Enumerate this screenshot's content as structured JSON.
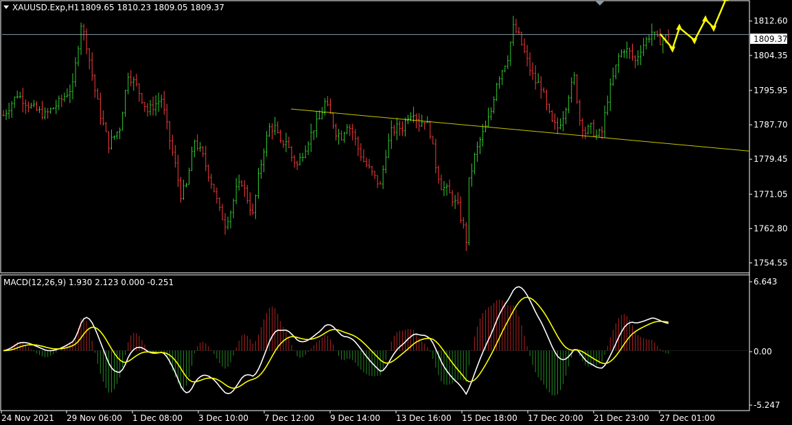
{
  "price_panel": {
    "symbol_label": "XAUUSD.Exp,H1",
    "ohlc_label": "1809.65 1810.23 1809.05 1809.37",
    "current_price": "1809.37",
    "price_ticks": [
      "1812.60",
      "1804.35",
      "1795.95",
      "1787.70",
      "1779.45",
      "1771.05",
      "1762.80",
      "1754.55"
    ]
  },
  "macd_panel": {
    "label": "MACD(12,26,9) 1.930 2.123 0.000 -0.251",
    "ticks": [
      "6.643",
      "0.00",
      "-5.247"
    ]
  },
  "time_ticks": [
    "24 Nov 2021",
    "29 Nov 06:00",
    "1 Dec 08:00",
    "3 Dec 10:00",
    "7 Dec 12:00",
    "9 Dec 14:00",
    "13 Dec 16:00",
    "15 Dec 18:00",
    "17 Dec 20:00",
    "21 Dec 23:00",
    "27 Dec 01:00"
  ],
  "chart_data": {
    "type": "candlestick",
    "symbol": "XAUUSD.Exp",
    "timeframe": "H1",
    "ohlc_last": {
      "open": 1809.65,
      "high": 1810.23,
      "low": 1809.05,
      "close": 1809.37
    },
    "ylim": [
      1752.5,
      1817.0
    ],
    "approx_price_path": [
      [
        0,
        1790
      ],
      [
        5,
        1795
      ],
      [
        10,
        1792
      ],
      [
        15,
        1790
      ],
      [
        20,
        1793
      ],
      [
        25,
        1797
      ],
      [
        28,
        1812
      ],
      [
        30,
        1807
      ],
      [
        33,
        1796
      ],
      [
        35,
        1790
      ],
      [
        38,
        1783
      ],
      [
        42,
        1787
      ],
      [
        45,
        1800
      ],
      [
        48,
        1797
      ],
      [
        52,
        1791
      ],
      [
        57,
        1794
      ],
      [
        60,
        1784
      ],
      [
        62,
        1778
      ],
      [
        64,
        1771
      ],
      [
        66,
        1773
      ],
      [
        69,
        1784
      ],
      [
        72,
        1780
      ],
      [
        74,
        1776
      ],
      [
        76,
        1772
      ],
      [
        78,
        1767
      ],
      [
        80,
        1764
      ],
      [
        82,
        1767
      ],
      [
        84,
        1772
      ],
      [
        86,
        1774
      ],
      [
        88,
        1770
      ],
      [
        90,
        1766
      ],
      [
        92,
        1775
      ],
      [
        94,
        1782
      ],
      [
        96,
        1787
      ],
      [
        98,
        1787
      ],
      [
        100,
        1783
      ],
      [
        102,
        1784
      ],
      [
        104,
        1780
      ],
      [
        106,
        1778
      ],
      [
        108,
        1781
      ],
      [
        110,
        1784
      ],
      [
        112,
        1787
      ],
      [
        114,
        1789
      ],
      [
        116,
        1793
      ],
      [
        118,
        1790
      ],
      [
        120,
        1786
      ],
      [
        122,
        1785
      ],
      [
        124,
        1788
      ],
      [
        126,
        1786
      ],
      [
        128,
        1782
      ],
      [
        130,
        1779
      ],
      [
        132,
        1777
      ],
      [
        134,
        1775
      ],
      [
        136,
        1773
      ],
      [
        138,
        1781
      ],
      [
        140,
        1786
      ],
      [
        142,
        1787
      ],
      [
        144,
        1787
      ],
      [
        146,
        1790
      ],
      [
        148,
        1791
      ],
      [
        150,
        1788
      ],
      [
        152,
        1789
      ],
      [
        154,
        1786
      ],
      [
        156,
        1778
      ],
      [
        158,
        1773
      ],
      [
        160,
        1772
      ],
      [
        162,
        1770
      ],
      [
        164,
        1768
      ],
      [
        166,
        1763
      ],
      [
        167,
        1760
      ],
      [
        168,
        1774
      ],
      [
        170,
        1780
      ],
      [
        172,
        1784
      ],
      [
        174,
        1787
      ],
      [
        176,
        1791
      ],
      [
        178,
        1798
      ],
      [
        180,
        1801
      ],
      [
        182,
        1804
      ],
      [
        184,
        1811
      ],
      [
        186,
        1809
      ],
      [
        188,
        1805
      ],
      [
        190,
        1801
      ],
      [
        192,
        1798
      ],
      [
        194,
        1797
      ],
      [
        196,
        1792
      ],
      [
        198,
        1788
      ],
      [
        200,
        1787
      ],
      [
        202,
        1790
      ],
      [
        204,
        1795
      ],
      [
        206,
        1799
      ],
      [
        208,
        1789
      ],
      [
        210,
        1786
      ],
      [
        212,
        1787
      ],
      [
        214,
        1785
      ],
      [
        216,
        1786
      ],
      [
        218,
        1794
      ],
      [
        220,
        1799
      ],
      [
        222,
        1804
      ],
      [
        224,
        1806
      ],
      [
        226,
        1805
      ],
      [
        228,
        1803
      ],
      [
        230,
        1806
      ],
      [
        232,
        1808
      ],
      [
        234,
        1810
      ],
      [
        236,
        1808
      ],
      [
        238,
        1808
      ],
      [
        240,
        1809.37
      ]
    ],
    "forecast_arrows_color": "#ffff00",
    "trendline": {
      "color": "#c8c800",
      "from": [
        "7 Dec 12:00",
        1791.5
      ],
      "to": [
        "27 Dec 01:00",
        1783.5
      ]
    },
    "horizontal_line": 1809.37,
    "bull_color": "#32cd32",
    "bear_color": "#ff3b3b",
    "macd": {
      "params": "12,26,9",
      "value": 1.93,
      "signal": 2.123,
      "ylim": [
        -5.247,
        6.643
      ],
      "main_color": "#ffffff",
      "signal_color": "#ffff00",
      "hist_pos_color": "#b22222",
      "hist_neg_color": "#228b22"
    }
  }
}
